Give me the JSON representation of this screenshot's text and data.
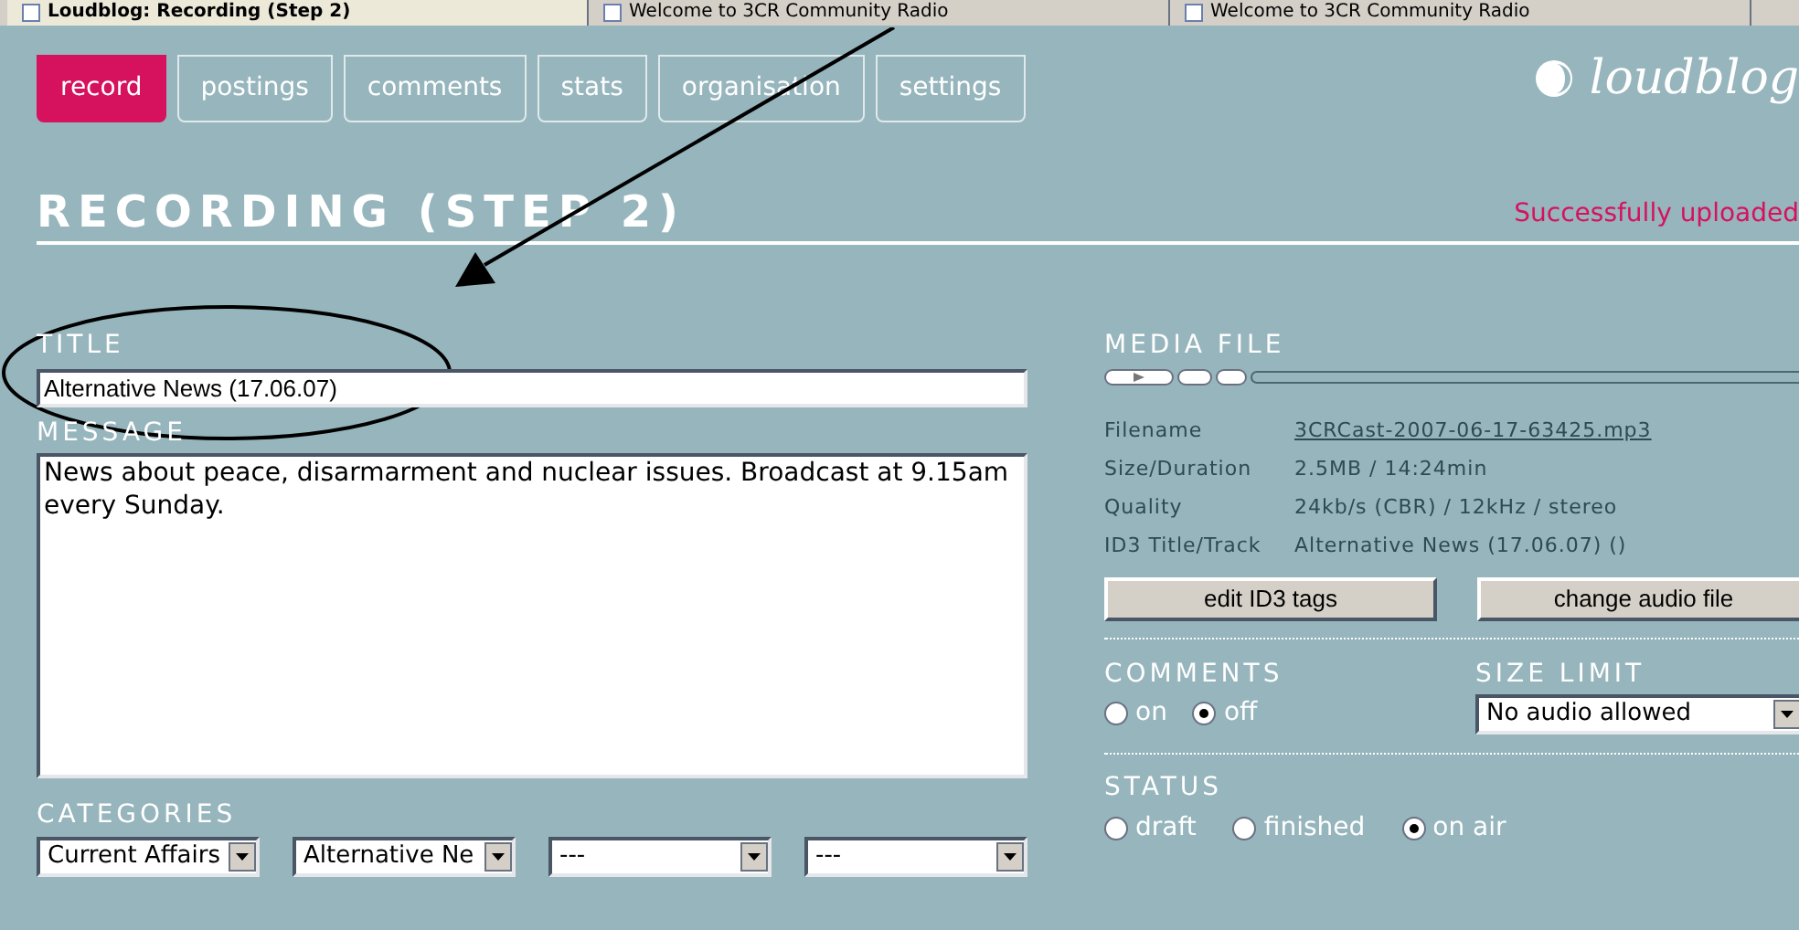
{
  "browser_tabs": [
    {
      "title": "Loudblog: Recording (Step 2)",
      "selected": true
    },
    {
      "title": "Welcome to 3CR Community Radio",
      "selected": false
    },
    {
      "title": "Welcome to 3CR Community Radio",
      "selected": false
    }
  ],
  "nav_tabs": [
    {
      "label": "record",
      "selected": true
    },
    {
      "label": "postings",
      "selected": false
    },
    {
      "label": "comments",
      "selected": false
    },
    {
      "label": "stats",
      "selected": false
    },
    {
      "label": "organisation",
      "selected": false
    },
    {
      "label": "settings",
      "selected": false
    }
  ],
  "logo": "loudblog",
  "heading": "RECORDING (STEP 2)",
  "status_message": "Successfully uploaded",
  "title_field": {
    "label": "TITLE",
    "value": "Alternative News (17.06.07)"
  },
  "message_field": {
    "label": "MESSAGE",
    "value": "News about peace, disarmarment and nuclear issues. Broadcast at 9.15am every Sunday."
  },
  "categories": {
    "label": "CATEGORIES",
    "selects": [
      "Current Affairs",
      "Alternative Ne",
      "---",
      "---"
    ]
  },
  "media_file": {
    "label": "MEDIA FILE",
    "info": [
      {
        "label": "Filename",
        "value": "3CRCast-2007-06-17-63425.mp3",
        "kind": "link"
      },
      {
        "label": "Size/Duration",
        "value": "2.5MB / 14:24min",
        "kind": "text"
      },
      {
        "label": "Quality",
        "value": "24kb/s (CBR) / 12kHz / stereo",
        "kind": "text"
      },
      {
        "label": "ID3 Title/Track",
        "value": "Alternative News (17.06.07) ()",
        "kind": "text"
      }
    ],
    "buttons": [
      "edit ID3 tags",
      "change audio file"
    ]
  },
  "comments": {
    "label": "COMMENTS",
    "options": [
      {
        "label": "on",
        "selected": false
      },
      {
        "label": "off",
        "selected": true
      }
    ]
  },
  "size_limit": {
    "label": "SIZE LIMIT",
    "value": "No audio allowed"
  },
  "status": {
    "label": "STATUS",
    "options": [
      {
        "label": "draft",
        "selected": false
      },
      {
        "label": "finished",
        "selected": false
      },
      {
        "label": "on air",
        "selected": true
      }
    ]
  }
}
